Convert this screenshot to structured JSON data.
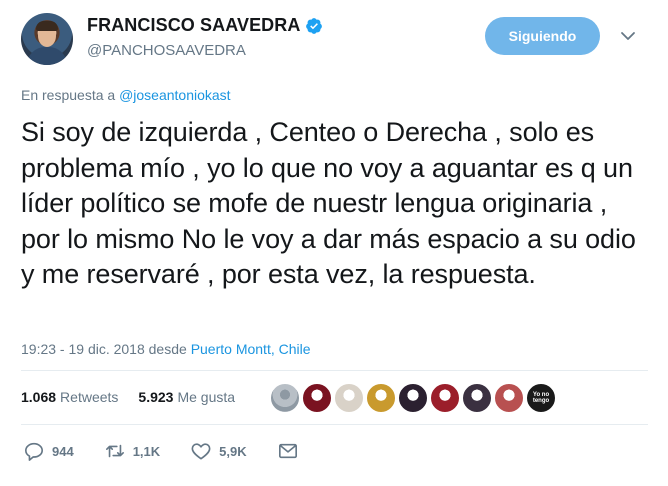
{
  "author": {
    "name": "FRANCISCO SAAVEDRA",
    "handle": "@PANCHOSAAVEDRA",
    "follow_label": "Siguiendo"
  },
  "reply": {
    "prefix": "En respuesta a",
    "mention": "@joseantoniokast"
  },
  "tweet": {
    "text": "Si soy de izquierda , Centeo o Derecha , solo es problema mío , yo lo que no voy a aguantar es q un líder político se mofe de nuestr lengua originaria , por lo mismo No le voy a dar más espacio a su odio y me reservaré , por esta vez, la respuesta."
  },
  "meta": {
    "timestamp": "19:23 - 19 dic. 2018 desde",
    "place": "Puerto Montt, Chile"
  },
  "stats": {
    "retweets_count": "1.068",
    "retweets_label": "Retweets",
    "likes_count": "5.923",
    "likes_label": "Me gusta",
    "liker_avatar_colors": [
      "#b8bfc6",
      "#7a1220",
      "#d9d2c8",
      "#c99a2e",
      "#2b2030",
      "#9b1e2a",
      "#3a3040",
      "#b85050",
      "#1a1a1a"
    ],
    "liker_badge_text": "Yo no tengo"
  },
  "actions": {
    "replies": "944",
    "retweets": "1,1K",
    "likes": "5,9K"
  },
  "icons": {
    "verified": "verified-badge-icon",
    "chevron": "chevron-down-icon",
    "reply": "reply-icon",
    "retweet": "retweet-icon",
    "like": "heart-icon",
    "dm": "envelope-icon"
  },
  "colors": {
    "accent": "#1b95e0",
    "follow_button": "#71b6ea",
    "muted": "#657786"
  }
}
